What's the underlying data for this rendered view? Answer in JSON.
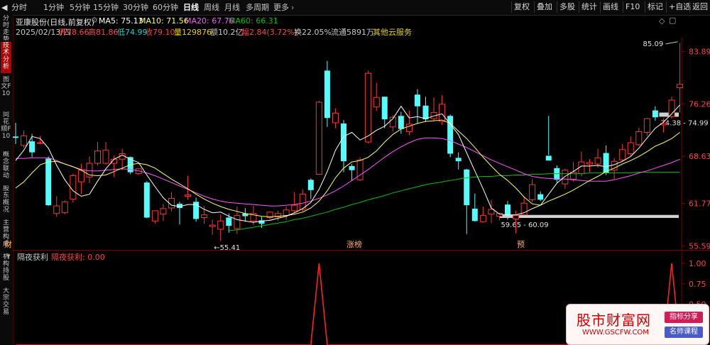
{
  "periods": {
    "items": [
      "分时",
      "1分钟",
      "5分钟",
      "15分钟",
      "30分钟",
      "60分钟",
      "日线",
      "周线",
      "月线",
      "多周期",
      "更多"
    ],
    "active": "日线"
  },
  "toolbar": [
    "复权",
    "叠加",
    "多股",
    "统计",
    "画线",
    "F10",
    "标记",
    "+自选",
    "返回"
  ],
  "sidebar_tabs": [
    "分时走势",
    "技术分析",
    "图文F10",
    "同花顺F10",
    "概念联动",
    "股东概况",
    "主营构成",
    "机构持股",
    "大宗交易"
  ],
  "info": {
    "stock": "亚康股份(日线,前复权)",
    "ma5": "MA5: 75.13",
    "ma10": "MA10: 71.56",
    "ma20": "MA20: 67.76",
    "ma60": "MA60: 66.31",
    "date": "2025/02/13/四",
    "open": "开78.66",
    "high": "高81.86",
    "low": "低74.99",
    "close": "收79.10",
    "volume": "量129876",
    "amount": "额10.2亿",
    "change": "幅2.84(3.72%)",
    "turnover": "换22.05%",
    "float": "流通5891万",
    "concept": "其他云服务"
  },
  "indicator": {
    "name": "隔夜获利",
    "value": "隔夜获利: 0.00"
  },
  "chart_data": [
    {
      "type": "candlestick",
      "y_ticks": [
        "83.89",
        "76.26",
        "68.63",
        "61.77",
        "55.59"
      ],
      "ylim": [
        55.0,
        86.0
      ],
      "annotations": {
        "high": "85.09",
        "low": "55.41",
        "band1": "74.38 - 74.99",
        "band2": "59.65 - 60.09",
        "marker1": "财",
        "marker2": "涨榜",
        "marker3": "预"
      },
      "colors": {
        "up": "#ff3333",
        "down": "#54fcfc",
        "ma5": "#ffffff",
        "ma10": "#ffff55",
        "ma20": "#ff55ff",
        "ma60": "#00c000"
      },
      "candles": [
        [
          71.5,
          71.3,
          73.5,
          70.4
        ],
        [
          70.2,
          71.6,
          72.4,
          69.9
        ],
        [
          70.8,
          69.2,
          71.9,
          68.5
        ],
        [
          70.5,
          70.6,
          71.6,
          70.4
        ],
        [
          68.3,
          61.5,
          68.6,
          61.4
        ],
        [
          60.3,
          61.4,
          62.8,
          59.8
        ],
        [
          60.4,
          62.0,
          62.2,
          60.2
        ],
        [
          62.4,
          65.8,
          66.1,
          61.9
        ],
        [
          64.9,
          66.6,
          67.5,
          63.1
        ],
        [
          65.6,
          67.6,
          68.6,
          64.7
        ],
        [
          67.6,
          69.4,
          70.7,
          67.3
        ],
        [
          67.6,
          69.5,
          70.7,
          67.4
        ],
        [
          67.6,
          68.2,
          68.7,
          65.6
        ],
        [
          68.2,
          69.0,
          69.7,
          66.6
        ],
        [
          68.5,
          66.3,
          68.6,
          66.0
        ],
        [
          66.1,
          66.8,
          66.9,
          65.9
        ],
        [
          64.8,
          59.7,
          65.0,
          59.6
        ],
        [
          59.2,
          60.7,
          60.7,
          58.8
        ],
        [
          60.2,
          61.0,
          61.7,
          59.2
        ],
        [
          61.1,
          62.5,
          63.4,
          60.6
        ],
        [
          61.7,
          61.1,
          62.0,
          58.7
        ],
        [
          62.8,
          63.0,
          65.8,
          62.3
        ],
        [
          62.0,
          59.5,
          62.6,
          59.1
        ],
        [
          59.7,
          60.1,
          61.4,
          58.8
        ],
        [
          58.4,
          58.6,
          59.4,
          57.2
        ],
        [
          58.0,
          59.2,
          60.1,
          56.3
        ],
        [
          59.7,
          58.5,
          60.3,
          57.5
        ],
        [
          58.1,
          60.0,
          61.3,
          57.3
        ],
        [
          60.3,
          59.9,
          61.1,
          59.1
        ],
        [
          59.2,
          60.3,
          61.4,
          58.6
        ],
        [
          59.3,
          58.8,
          59.8,
          58.2
        ],
        [
          59.7,
          60.5,
          60.6,
          59.4
        ],
        [
          59.8,
          60.3,
          60.7,
          59.2
        ],
        [
          60.0,
          60.8,
          61.3,
          59.3
        ],
        [
          60.7,
          61.5,
          63.4,
          60.3
        ],
        [
          60.9,
          63.1,
          63.8,
          60.6
        ],
        [
          65.2,
          63.7,
          65.4,
          62.4
        ],
        [
          66.0,
          76.5,
          76.7,
          66.0
        ],
        [
          81.1,
          74.2,
          82.5,
          72.9
        ],
        [
          73.5,
          74.9,
          75.6,
          72.7
        ],
        [
          73.4,
          67.9,
          73.9,
          66.3
        ],
        [
          67.2,
          66.6,
          67.5,
          65.1
        ],
        [
          65.2,
          68.1,
          68.5,
          65.0
        ],
        [
          70.7,
          80.7,
          81.1,
          70.5
        ],
        [
          75.8,
          77.2,
          79.3,
          75.2
        ],
        [
          77.3,
          74.0,
          77.0,
          72.7
        ],
        [
          72.9,
          74.3,
          74.6,
          72.2
        ],
        [
          74.5,
          72.6,
          75.1,
          71.9
        ],
        [
          72.2,
          73.3,
          75.3,
          71.7
        ],
        [
          77.6,
          75.9,
          78.4,
          73.4
        ],
        [
          76.0,
          74.0,
          77.3,
          73.6
        ],
        [
          74.1,
          75.0,
          77.2,
          73.8
        ],
        [
          73.7,
          76.2,
          77.5,
          73.2
        ],
        [
          74.5,
          69.0,
          74.7,
          68.5
        ],
        [
          68.4,
          67.9,
          69.2,
          66.7
        ],
        [
          66.7,
          61.5,
          66.8,
          57.3
        ],
        [
          61.0,
          59.2,
          63.2,
          59.1
        ],
        [
          59.1,
          60.0,
          61.3,
          59.0
        ],
        [
          60.2,
          60.9,
          62.3,
          58.9
        ],
        [
          59.9,
          60.3,
          60.4,
          59.3
        ],
        [
          61.6,
          60.0,
          62.1,
          59.4
        ],
        [
          59.5,
          60.0,
          60.7,
          57.4
        ],
        [
          60.1,
          61.8,
          62.8,
          60.1
        ],
        [
          62.3,
          64.5,
          65.3,
          61.9
        ],
        [
          63.1,
          62.3,
          63.5,
          62.1
        ],
        [
          68.7,
          68.0,
          74.5,
          68.8
        ],
        [
          66.9,
          65.2,
          67.3,
          64.8
        ],
        [
          64.6,
          66.6,
          66.8,
          63.9
        ],
        [
          65.3,
          66.3,
          67.8,
          64.9
        ],
        [
          66.1,
          67.8,
          69.3,
          65.7
        ],
        [
          67.5,
          67.7,
          68.2,
          66.3
        ],
        [
          67.5,
          68.4,
          69.7,
          67.0
        ],
        [
          69.1,
          66.2,
          70.2,
          65.9
        ],
        [
          66.6,
          67.9,
          68.4,
          65.3
        ],
        [
          68.1,
          69.6,
          70.4,
          67.9
        ],
        [
          69.0,
          70.6,
          71.5,
          68.7
        ],
        [
          70.3,
          72.2,
          72.8,
          70.1
        ],
        [
          72.1,
          74.1,
          74.2,
          71.6
        ],
        [
          75.3,
          74.3,
          75.9,
          73.8
        ],
        [
          73.2,
          73.4,
          74.1,
          72.1
        ],
        [
          74.4,
          76.8,
          77.3,
          74.1
        ],
        [
          78.6,
          79.1,
          85.1,
          75.0
        ]
      ],
      "ma5": [
        68.0,
        69.5,
        71.5,
        71.2,
        69.8,
        67.3,
        65.2,
        63.6,
        62.8,
        63.1,
        65.0,
        66.8,
        68.2,
        68.8,
        68.2,
        67.7,
        65.9,
        64.2,
        62.6,
        61.5,
        61.3,
        61.6,
        61.6,
        60.9,
        60.4,
        60.5,
        59.9,
        59.4,
        59.2,
        59.0,
        59.2,
        59.3,
        59.6,
        59.9,
        60.4,
        61.0,
        61.9,
        63.8,
        66.4,
        69.5,
        71.5,
        72.1,
        71.0,
        71.6,
        72.4,
        73.0,
        74.1,
        75.9,
        74.2,
        74.4,
        74.1,
        74.5,
        74.8,
        73.3,
        71.8,
        69.1,
        66.5,
        63.9,
        61.1,
        60.2,
        60.1,
        60.1,
        60.4,
        61.0,
        61.5,
        63.1,
        64.7,
        65.7,
        66.4,
        67.2,
        67.2,
        67.3,
        67.1,
        67.4,
        67.9,
        68.6,
        69.8,
        71.3,
        72.7,
        73.6,
        74.8,
        76.1
      ],
      "ma10": [
        64.0,
        64.9,
        66.2,
        67.4,
        67.8,
        67.9,
        67.5,
        67.1,
        66.6,
        65.9,
        65.8,
        65.9,
        66.4,
        66.9,
        67.4,
        67.6,
        67.4,
        66.9,
        66.1,
        65.3,
        64.6,
        63.9,
        63.1,
        62.4,
        61.8,
        61.3,
        60.9,
        60.6,
        60.3,
        60.1,
        59.9,
        59.8,
        59.9,
        60.0,
        60.2,
        60.5,
        61.1,
        62.1,
        63.6,
        65.5,
        66.9,
        67.8,
        68.0,
        68.5,
        69.4,
        70.7,
        71.8,
        72.6,
        73.0,
        73.4,
        73.7,
        73.8,
        73.9,
        73.4,
        72.3,
        71.2,
        69.9,
        68.5,
        67.2,
        66.0,
        65.1,
        64.0,
        62.7,
        61.7,
        61.5,
        62.1,
        62.6,
        63.1,
        63.7,
        64.4,
        65.1,
        65.7,
        66.4,
        66.9,
        67.5,
        68.0,
        68.6,
        69.3,
        70.1,
        70.6,
        71.2,
        72.1
      ],
      "ma20": [
        68.3,
        68.3,
        68.4,
        68.4,
        68.4,
        68.0,
        67.5,
        67.1,
        66.7,
        66.5,
        66.5,
        66.6,
        66.7,
        66.8,
        66.7,
        66.5,
        66.2,
        65.8,
        65.3,
        64.8,
        64.3,
        63.8,
        63.3,
        62.8,
        62.4,
        62.1,
        61.9,
        61.8,
        61.7,
        61.6,
        61.5,
        61.4,
        61.4,
        61.5,
        61.6,
        61.8,
        62.1,
        62.5,
        63.0,
        63.6,
        64.3,
        65.1,
        65.9,
        66.7,
        67.6,
        68.5,
        69.3,
        70.0,
        70.6,
        71.1,
        71.3,
        71.3,
        71.2,
        70.9,
        70.4,
        69.9,
        69.3,
        68.7,
        68.1,
        67.6,
        67.1,
        66.6,
        66.1,
        65.7,
        65.5,
        65.4,
        65.3,
        65.3,
        65.2,
        65.1,
        65.0,
        65.0,
        65.0,
        65.2,
        65.5,
        65.8,
        66.2,
        66.5,
        66.9,
        67.3,
        67.7,
        68.2
      ],
      "ma60": [
        null,
        null,
        null,
        null,
        null,
        null,
        null,
        null,
        null,
        null,
        null,
        null,
        null,
        null,
        null,
        null,
        null,
        null,
        null,
        null,
        null,
        null,
        null,
        null,
        null,
        null,
        57.8,
        57.9,
        58.1,
        58.3,
        58.5,
        58.7,
        58.9,
        59.1,
        59.4,
        59.6,
        59.9,
        60.2,
        60.5,
        60.9,
        61.2,
        61.6,
        61.9,
        62.3,
        62.6,
        62.9,
        63.3,
        63.6,
        63.9,
        64.2,
        64.5,
        64.7,
        64.9,
        65.1,
        65.3,
        65.5,
        65.6,
        65.7,
        65.7,
        65.8,
        65.8,
        65.9,
        65.9,
        66.0,
        66.0,
        66.1,
        66.1,
        66.1,
        66.1,
        66.1,
        66.2,
        66.2,
        66.2,
        66.2,
        66.2,
        66.2,
        66.3,
        66.3,
        66.3,
        66.3,
        66.3,
        66.3
      ]
    },
    {
      "type": "line",
      "series_name": "隔夜获利",
      "y_ticks": [
        "1.00",
        "0.75",
        "0.50",
        "0.25"
      ],
      "ylim": [
        0,
        1
      ],
      "spikes_at": [
        37,
        80
      ]
    }
  ]
}
